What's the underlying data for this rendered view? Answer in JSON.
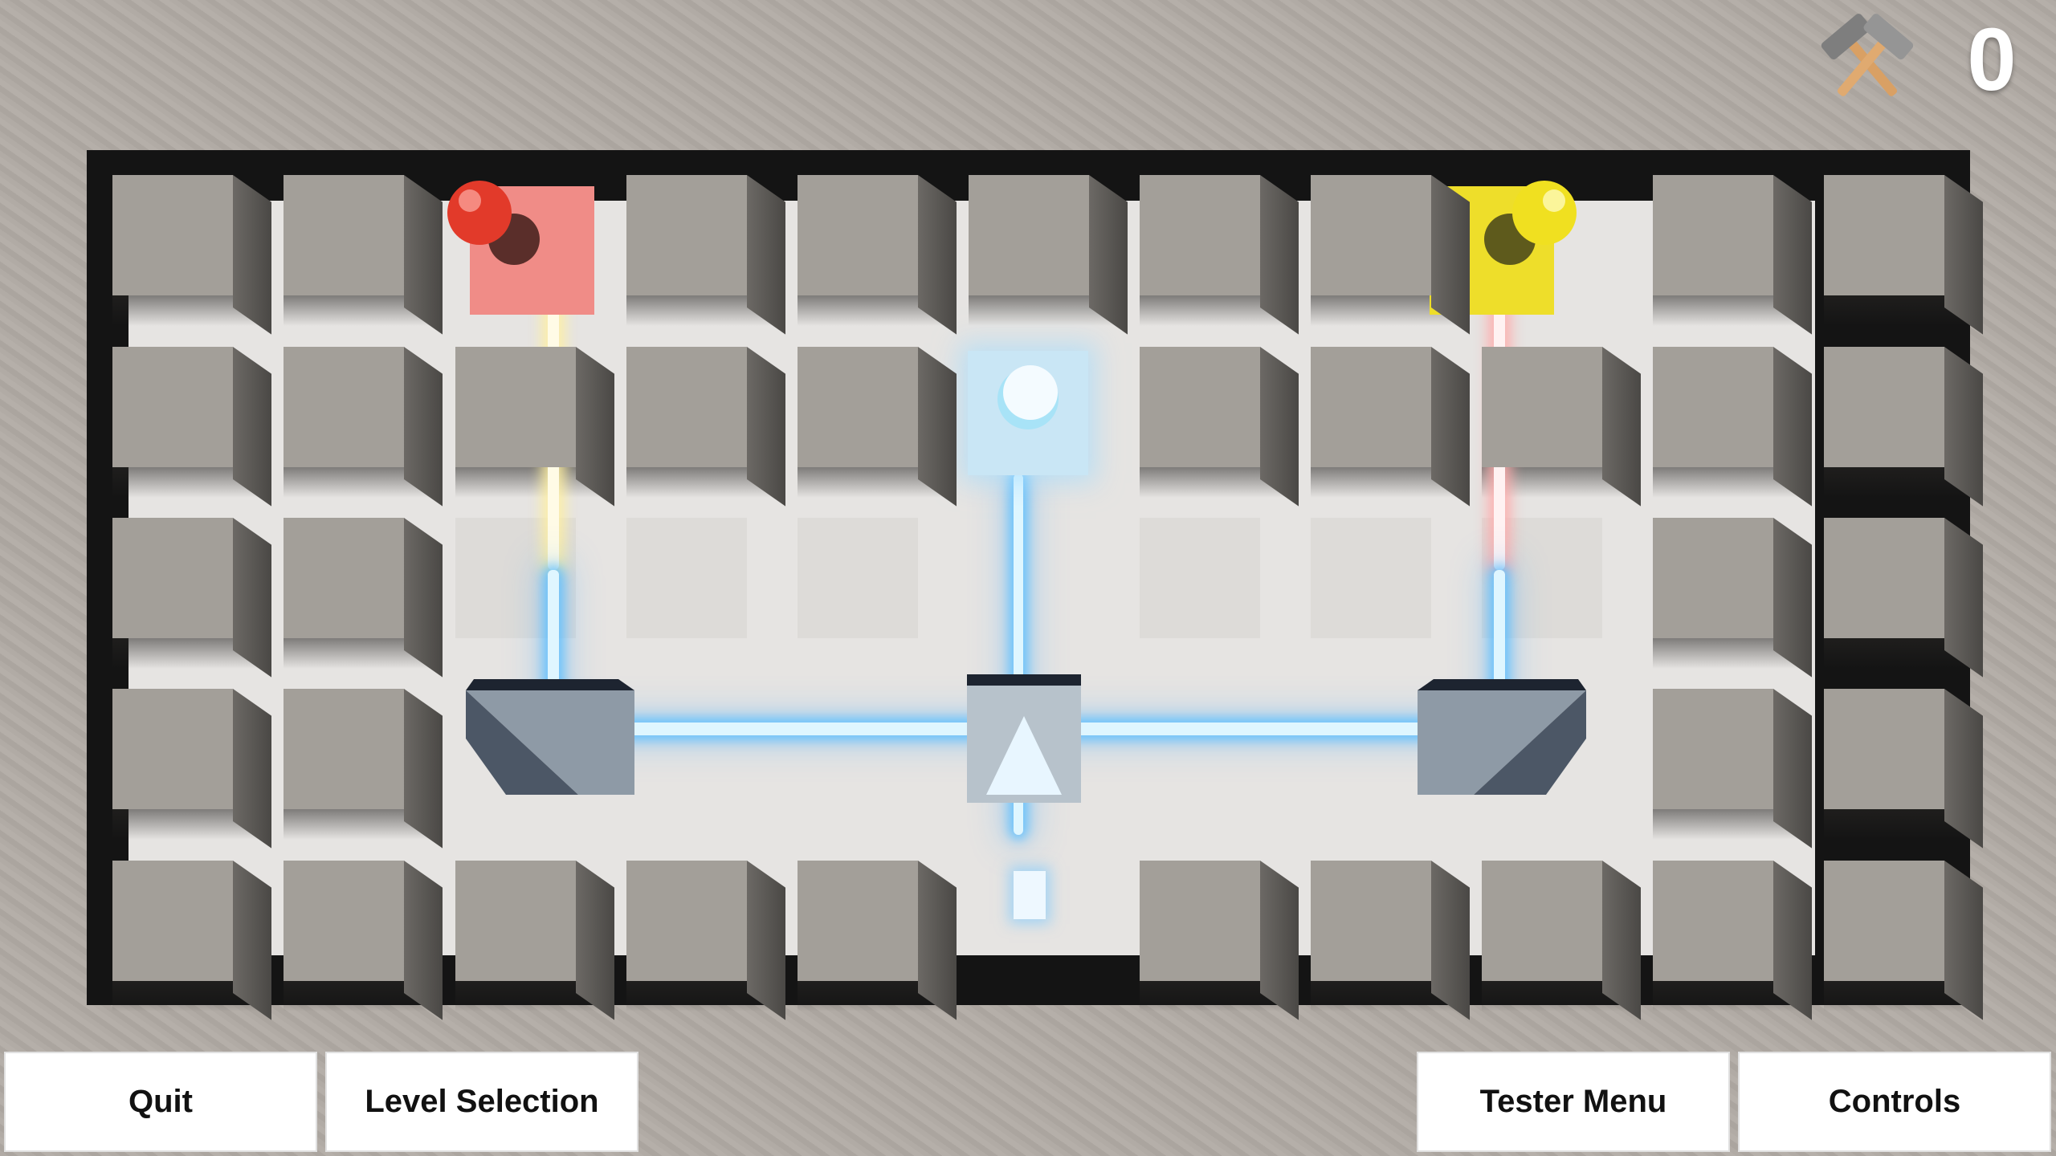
{
  "hud": {
    "icon": "crossed-hammers-icon",
    "count": "0"
  },
  "board": {
    "rows": 5,
    "cols": 11,
    "emitters": [
      {
        "color": "#f08a8a",
        "knob_color": "#e23a2a",
        "row": 1,
        "col": 3
      },
      {
        "color": "#f0e030",
        "knob_color": "#f0e020",
        "row": 1,
        "col": 9
      }
    ],
    "receiver": {
      "color": "#c9e6f5",
      "row": 2,
      "col": 6
    },
    "beam_color": "#5ac8ff"
  },
  "buttons": {
    "quit": "Quit",
    "level_selection": "Level Selection",
    "tester_menu": "Tester Menu",
    "controls": "Controls"
  }
}
